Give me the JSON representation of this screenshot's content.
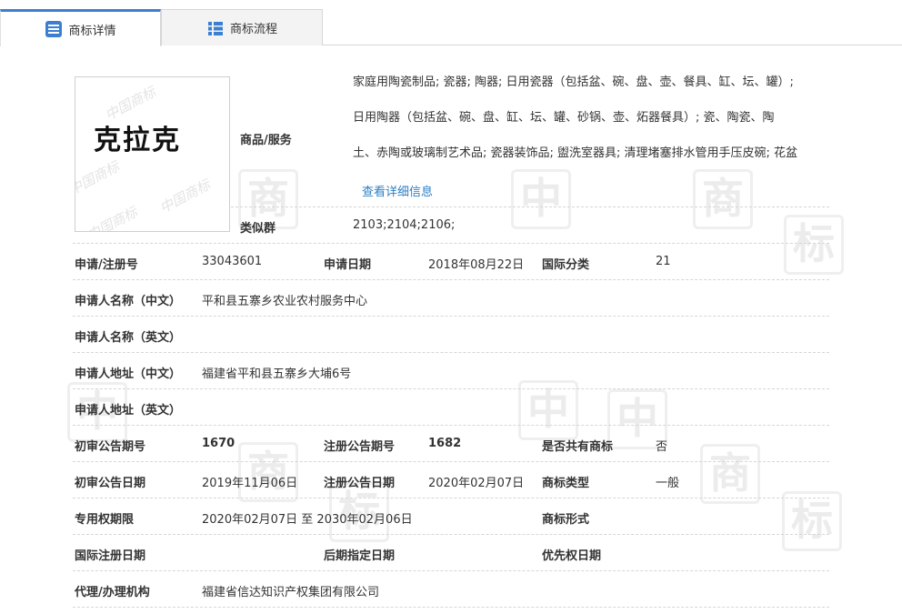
{
  "tabs": {
    "detail": "商标详情",
    "flow": "商标流程"
  },
  "watermark": {
    "char1": "商",
    "char2": "标",
    "char3": "中",
    "char4": "国"
  },
  "trademark": {
    "mark_text": "克拉克",
    "image_watermark": "中国商标"
  },
  "goods": {
    "label": "商品/服务",
    "lines": [
      "家庭用陶瓷制品; 瓷器; 陶器; 日用瓷器（包括盆、碗、盘、壶、餐具、缸、坛、罐）;",
      "日用陶器（包括盆、碗、盘、缸、坛、罐、砂锅、壶、炻器餐具）; 瓷、陶瓷、陶",
      "土、赤陶或玻璃制艺术品; 瓷器装饰品; 盥洗室器具; 清理堵塞排水管用手压皮碗; 花盆"
    ],
    "more_link": "查看详细信息"
  },
  "similar_group": {
    "label": "类似群",
    "value": "2103;2104;2106;"
  },
  "fields": {
    "reg_no_label": "申请/注册号",
    "reg_no": "33043601",
    "apply_date_label": "申请日期",
    "apply_date": "2018年08月22日",
    "intl_class_label": "国际分类",
    "intl_class": "21",
    "applicant_cn_label": "申请人名称（中文）",
    "applicant_cn": "平和县五寨乡农业农村服务中心",
    "applicant_en_label": "申请人名称（英文）",
    "applicant_en": "",
    "address_cn_label": "申请人地址（中文）",
    "address_cn": "福建省平和县五寨乡大埔6号",
    "address_en_label": "申请人地址（英文）",
    "address_en": "",
    "prelim_no_label": "初审公告期号",
    "prelim_no": "1670",
    "reg_notice_no_label": "注册公告期号",
    "reg_notice_no": "1682",
    "shared_label": "是否共有商标",
    "shared": "否",
    "prelim_date_label": "初审公告日期",
    "prelim_date": "2019年11月06日",
    "reg_notice_date_label": "注册公告日期",
    "reg_notice_date": "2020年02月07日",
    "tm_type_label": "商标类型",
    "tm_type": "一般",
    "exclusive_label": "专用权期限",
    "exclusive": "2020年02月07日 至 2030年02月06日",
    "tm_form_label": "商标形式",
    "tm_form": "",
    "intl_reg_date_label": "国际注册日期",
    "intl_reg_date": "",
    "later_date_label": "后期指定日期",
    "later_date": "",
    "priority_date_label": "优先权日期",
    "priority_date": "",
    "agent_label": "代理/办理机构",
    "agent": "福建省信达知识产权集团有限公司"
  }
}
